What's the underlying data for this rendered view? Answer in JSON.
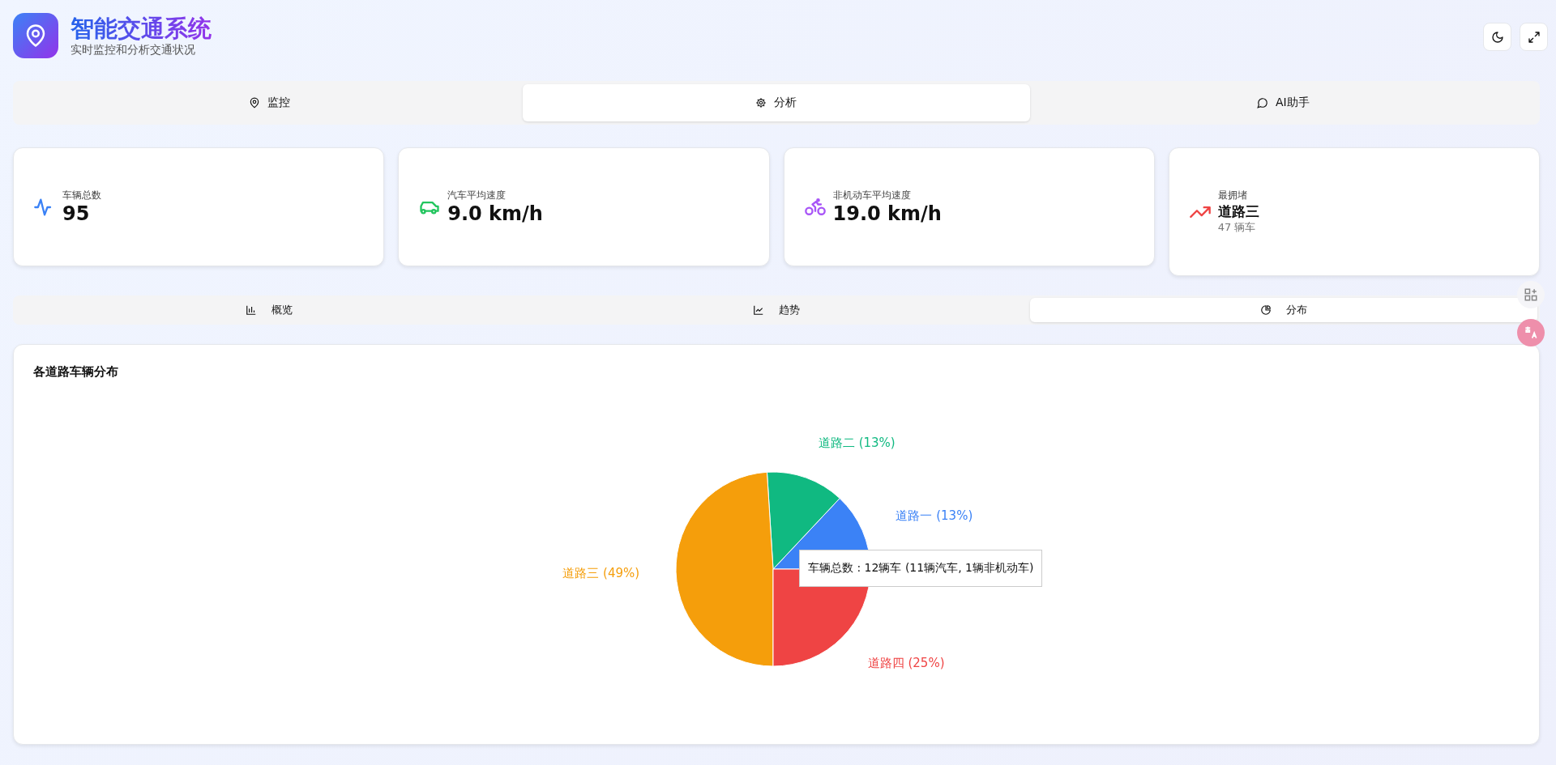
{
  "header": {
    "title": "智能交通系统",
    "subtitle": "实时监控和分析交通状况"
  },
  "main_tabs": [
    {
      "label": "监控",
      "selected": false
    },
    {
      "label": "分析",
      "selected": true
    },
    {
      "label": "AI助手",
      "selected": false
    }
  ],
  "stats": [
    {
      "label": "车辆总数",
      "value": "95"
    },
    {
      "label": "汽车平均速度",
      "value": "9.0 km/h"
    },
    {
      "label": "非机动车平均速度",
      "value": "19.0 km/h"
    },
    {
      "label": "最拥堵",
      "value": "道路三",
      "note": "47 辆车"
    }
  ],
  "sub_tabs": [
    {
      "label": "概览",
      "selected": false
    },
    {
      "label": "趋势",
      "selected": false
    },
    {
      "label": "分布",
      "selected": true
    }
  ],
  "chart_card": {
    "chart_data": {
      "type": "pie",
      "title": "各道路车辆分布",
      "categories": [
        "道路一",
        "道路二",
        "道路三",
        "道路四"
      ],
      "series": [
        {
          "name": "车辆总数",
          "values": [
            13,
            13,
            49,
            25
          ]
        }
      ],
      "colors": [
        "#3b82f6",
        "#10b981",
        "#f59e0b",
        "#ef4444"
      ],
      "value_labels": [
        "(13%)",
        "(13%)",
        "(49%)",
        "(25%)"
      ]
    },
    "tooltip_value": ": 12辆车 (11辆汽车, 1辆非机动车)"
  }
}
